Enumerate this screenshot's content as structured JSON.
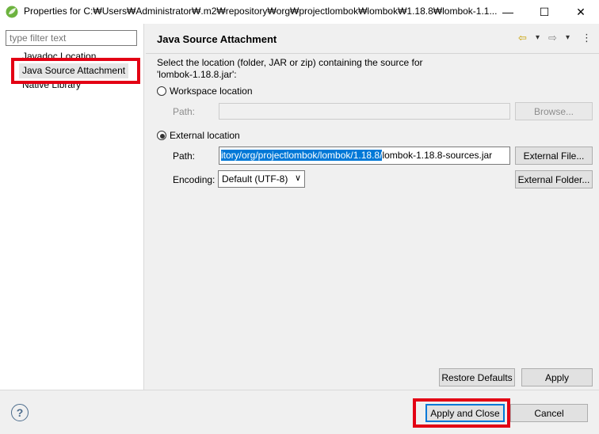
{
  "window": {
    "title": "Properties for C:₩Users₩Administrator₩.m2₩repository₩org₩projectlombok₩lombok₩1.18.8₩lombok-1.1...",
    "minimize": "—",
    "maximize": "☐",
    "close": "✕"
  },
  "sidebar": {
    "filter_placeholder": "type filter text",
    "items": [
      {
        "label": "Javadoc Location"
      },
      {
        "label": "Java Source Attachment"
      },
      {
        "label": "Native Library"
      }
    ]
  },
  "page": {
    "title": "Java Source Attachment",
    "back_icon": "⇦",
    "back_menu_icon": "▾",
    "forward_icon": "⇨",
    "forward_menu_icon": "▾",
    "menu_icon": "⋮",
    "description_line1": "Select the location (folder, JAR or zip) containing the source for",
    "description_line2": "'lombok-1.18.8.jar':",
    "workspace": {
      "label": "Workspace location",
      "path_label": "Path:",
      "path_value": "",
      "browse": "Browse..."
    },
    "external": {
      "label": "External location",
      "path_label": "Path:",
      "path_selected": "itory/org/projectlombok/lombok/1.18.8/",
      "path_rest": "lombok-1.18.8-sources.jar",
      "external_file": "External File...",
      "encoding_label": "Encoding:",
      "encoding_value": "Default (UTF-8)",
      "external_folder": "External Folder..."
    },
    "restore_defaults": "Restore Defaults",
    "apply": "Apply"
  },
  "footer": {
    "help_icon": "?",
    "apply_and_close": "Apply and Close",
    "cancel": "Cancel"
  },
  "colors": {
    "highlight_box": "#e30014",
    "selection": "#0078d7"
  }
}
